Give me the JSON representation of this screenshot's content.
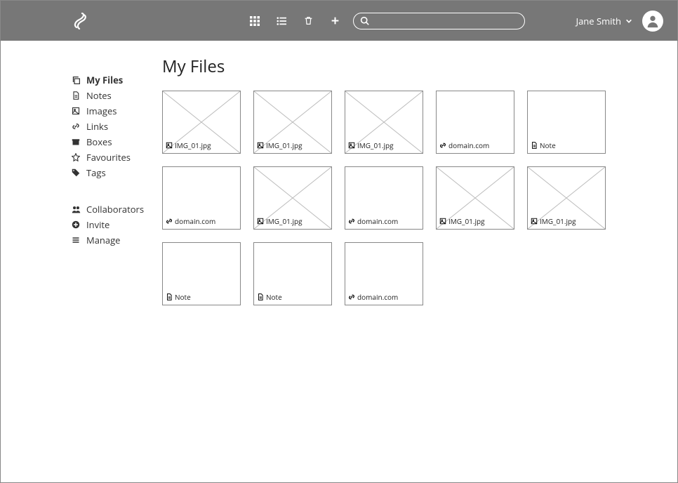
{
  "header": {
    "user_name": "Jane Smith",
    "search_placeholder": ""
  },
  "sidebar": {
    "nav": [
      {
        "icon": "copy-icon",
        "label": "My Files",
        "active": true
      },
      {
        "icon": "file-icon",
        "label": "Notes",
        "active": false
      },
      {
        "icon": "image-icon",
        "label": "Images",
        "active": false
      },
      {
        "icon": "link-icon",
        "label": "Links",
        "active": false
      },
      {
        "icon": "box-icon",
        "label": "Boxes",
        "active": false
      },
      {
        "icon": "star-icon",
        "label": "Favourites",
        "active": false
      },
      {
        "icon": "tag-icon",
        "label": "Tags",
        "active": false
      }
    ],
    "admin": [
      {
        "icon": "users-icon",
        "label": "Collaborators"
      },
      {
        "icon": "plus-circle-icon",
        "label": "Invite"
      },
      {
        "icon": "list-icon",
        "label": "Manage"
      }
    ]
  },
  "main": {
    "title": "My Files",
    "files": [
      {
        "type": "image",
        "label": "IMG_01.jpg",
        "cross": true
      },
      {
        "type": "image",
        "label": "IMG_01.jpg",
        "cross": true
      },
      {
        "type": "image",
        "label": "IMG_01.jpg",
        "cross": true
      },
      {
        "type": "link",
        "label": "domain.com",
        "cross": false
      },
      {
        "type": "note",
        "label": "Note",
        "cross": false
      },
      {
        "type": "link",
        "label": "domain.com",
        "cross": false
      },
      {
        "type": "image",
        "label": "IMG_01.jpg",
        "cross": true
      },
      {
        "type": "link",
        "label": "domain.com",
        "cross": false
      },
      {
        "type": "image",
        "label": "IMG_01.jpg",
        "cross": true
      },
      {
        "type": "image",
        "label": "IMG_01.jpg",
        "cross": true
      },
      {
        "type": "note",
        "label": "Note",
        "cross": false
      },
      {
        "type": "note",
        "label": "Note",
        "cross": false
      },
      {
        "type": "link",
        "label": "domain.com",
        "cross": false
      }
    ]
  }
}
